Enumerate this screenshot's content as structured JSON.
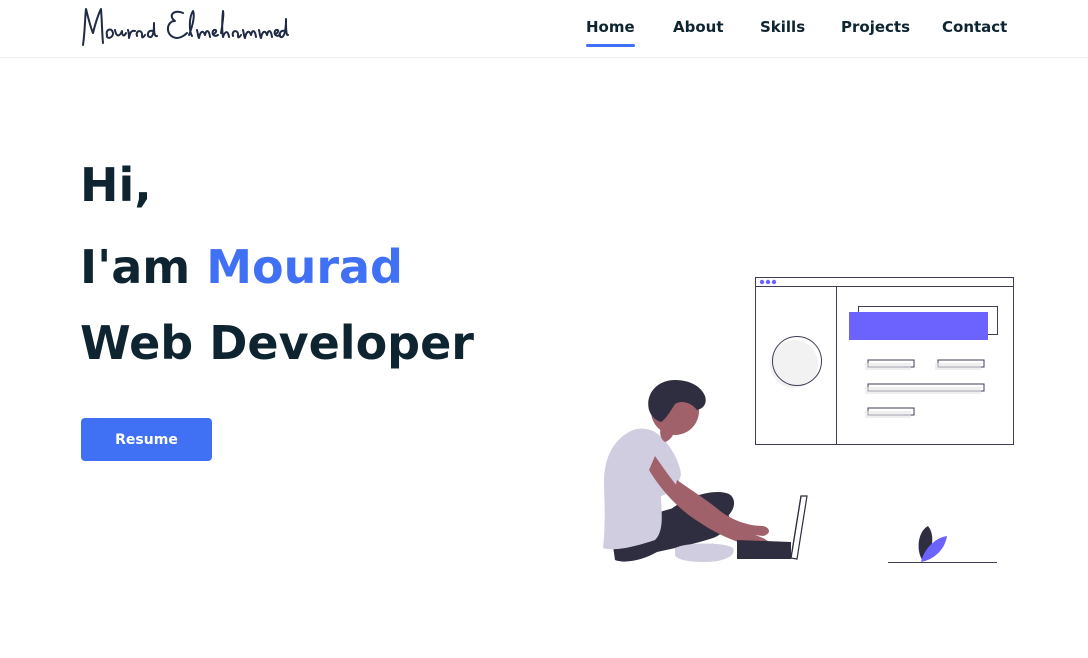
{
  "brand": {
    "name": "Mourad Elmehammedi"
  },
  "nav": {
    "items": [
      "Home",
      "About",
      "Skills",
      "Projects",
      "Contact"
    ],
    "active": "Home"
  },
  "hero": {
    "greeting": "Hi,",
    "intro_prefix": "I'am ",
    "intro_name": "Mourad",
    "role": "Web Developer",
    "button_label": "Resume"
  },
  "colors": {
    "accent": "#4070f4",
    "text": "#0e2431",
    "illustration_purple": "#6c63ff",
    "illustration_skin": "#a0616a",
    "illustration_shirt": "#d0cde1",
    "illustration_dark": "#2f2e41"
  },
  "illustration": {
    "name": "developer-with-laptop-illustration"
  }
}
